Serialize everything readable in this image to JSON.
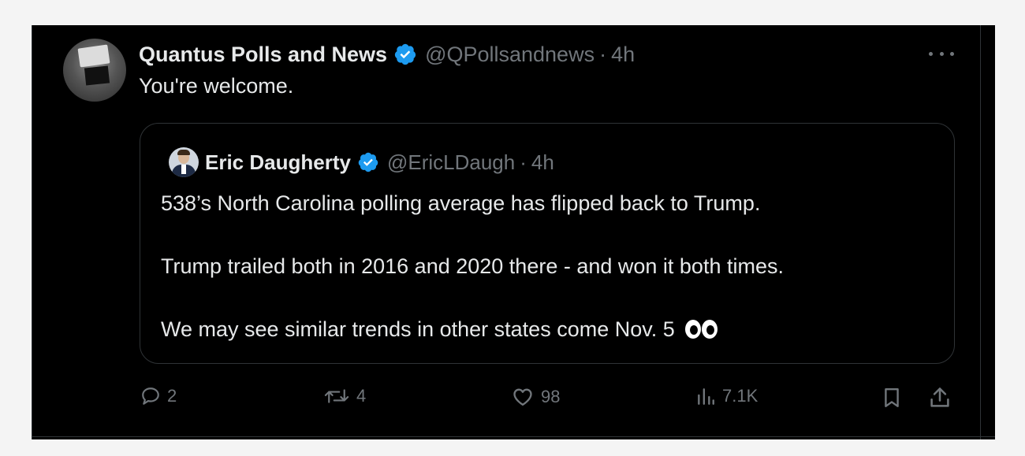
{
  "tweet": {
    "author_name": "Quantus Polls and News",
    "author_handle": "@QPollsandnews",
    "separator": "·",
    "time": "4h",
    "text": "You're welcome."
  },
  "quoted": {
    "author_name": "Eric Daugherty",
    "author_handle": "@EricLDaugh",
    "separator": "·",
    "time": "4h",
    "lines": [
      "538’s North Carolina polling average has flipped back to Trump.",
      "Trump trailed both in 2016 and 2020 there - and won it both times.",
      "We may see similar trends in other states come Nov. 5"
    ],
    "emoji": "eyes-emoji"
  },
  "actions": {
    "replies": "2",
    "reposts": "4",
    "likes": "98",
    "views": "7.1K"
  },
  "colors": {
    "background": "#000000",
    "text": "#e7e9ea",
    "muted": "#71767b",
    "border": "#2f3336",
    "verified": "#1d9bf0"
  },
  "icons": [
    "verified-badge-icon",
    "more-icon",
    "reply-icon",
    "repost-icon",
    "like-icon",
    "views-icon",
    "bookmark-icon",
    "share-icon"
  ]
}
